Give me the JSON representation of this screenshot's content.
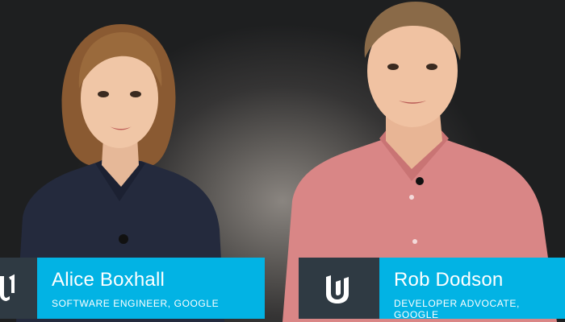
{
  "speakers": [
    {
      "name": "Alice Boxhall",
      "title": "SOFTWARE ENGINEER, GOOGLE"
    },
    {
      "name": "Rob Dodson",
      "title": "DEVELOPER ADVOCATE, GOOGLE"
    }
  ],
  "logo": {
    "icon": "udacity-u-icon"
  },
  "colors": {
    "accent": "#02b3e4",
    "logo_bg": "#2f3a43",
    "background": "#2b2b2c"
  }
}
